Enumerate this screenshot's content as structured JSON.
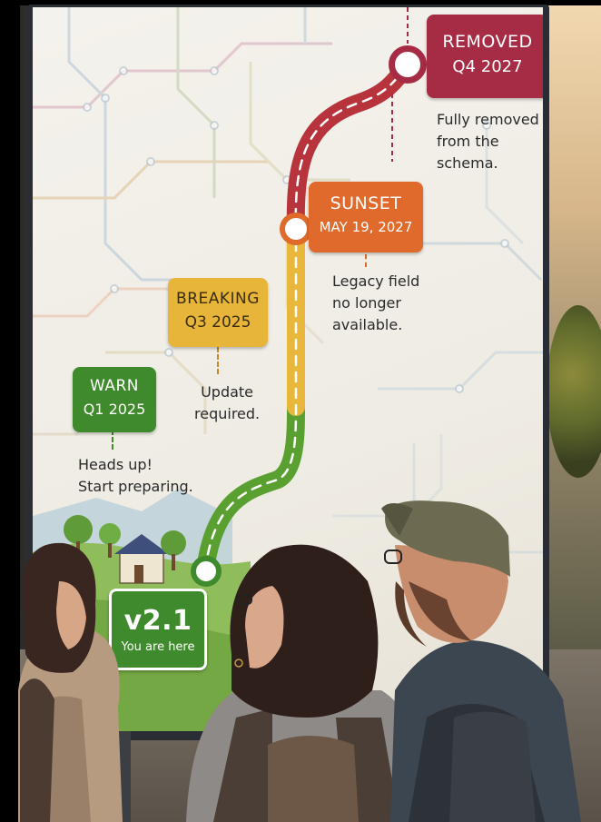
{
  "timeline": {
    "current": {
      "version": "v2.1",
      "caption": "You are here",
      "color": "#3f8a2c"
    },
    "stages": [
      {
        "id": "warn",
        "title": "WARN",
        "date": "Q1 2025",
        "note_lines": [
          "Heads up!",
          "Start preparing."
        ],
        "color": "#3f8a2c"
      },
      {
        "id": "breaking",
        "title": "BREAKING",
        "date": "Q3 2025",
        "note_lines": [
          "Update",
          "required."
        ],
        "color": "#e7b53a"
      },
      {
        "id": "sunset",
        "title": "SUNSET",
        "date": "MAY 19, 2027",
        "note_lines": [
          "Legacy field",
          "no longer",
          "available."
        ],
        "color": "#df6a2b"
      },
      {
        "id": "removed",
        "title": "REMOVED",
        "date": "Q4 2027",
        "note_lines": [
          "Fully removed",
          "from the",
          "schema."
        ],
        "color": "#a62b44"
      }
    ]
  },
  "path_colors": {
    "green": "#5aa031",
    "yellow": "#e8b73c",
    "red": "#b8343d"
  }
}
